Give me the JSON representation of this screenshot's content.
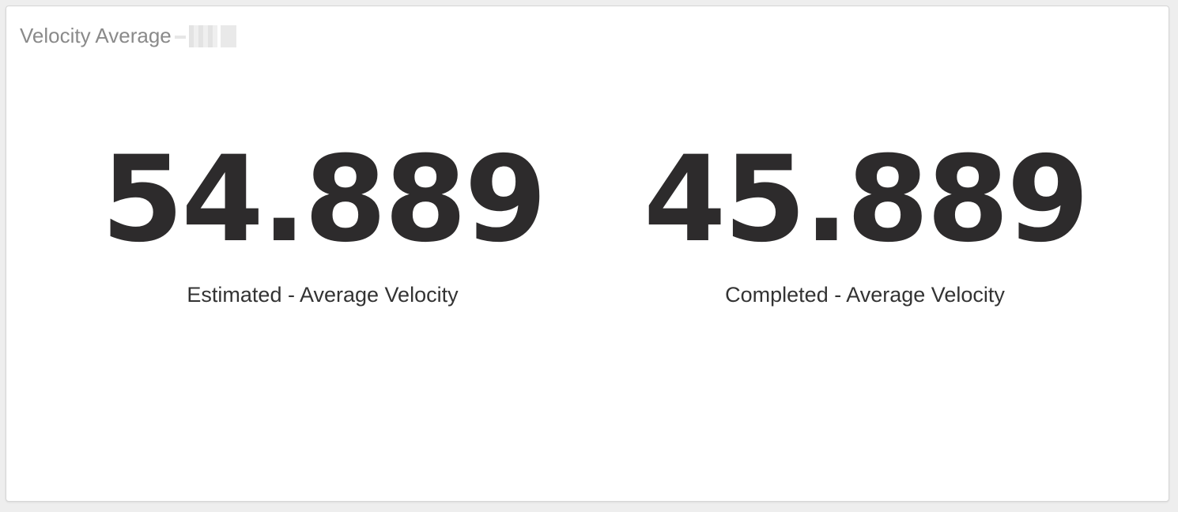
{
  "widget": {
    "title": "Velocity Average"
  },
  "metrics": [
    {
      "value": "54.889",
      "label": "Estimated - Average Velocity"
    },
    {
      "value": "45.889",
      "label": "Completed - Average Velocity"
    }
  ],
  "colors": {
    "value_text": "#2d2b2c",
    "title_text": "#8a8a8a",
    "card_background": "#ffffff"
  }
}
